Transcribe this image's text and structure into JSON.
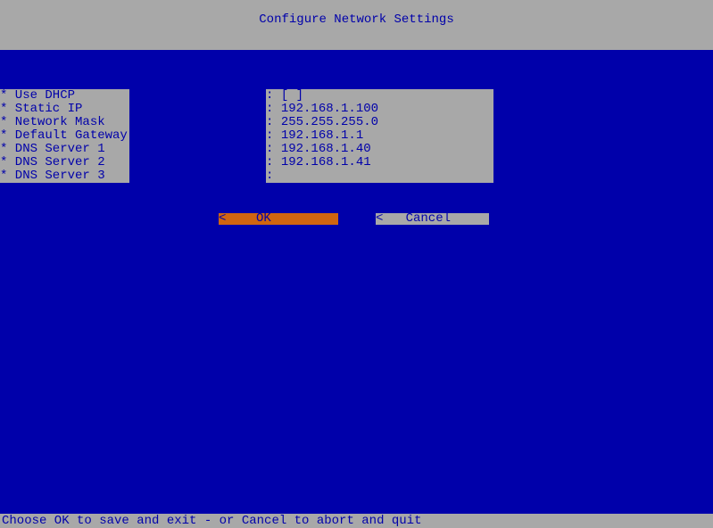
{
  "title": "Configure Network Settings",
  "fields": [
    {
      "label": "* Use DHCP",
      "value": "[ ]"
    },
    {
      "label": "* Static IP",
      "value": "192.168.1.100"
    },
    {
      "label": "* Network Mask",
      "value": "255.255.255.0"
    },
    {
      "label": "* Default Gateway",
      "value": "192.168.1.1"
    },
    {
      "label": "* DNS Server 1",
      "value": "192.168.1.40"
    },
    {
      "label": "* DNS Server 2",
      "value": "192.168.1.41"
    },
    {
      "label": "* DNS Server 3",
      "value": ""
    }
  ],
  "buttons": {
    "ok": "<    OK           >",
    "cancel": "<   Cancel        >"
  },
  "status": "Choose OK to save and exit - or Cancel to abort and quit"
}
